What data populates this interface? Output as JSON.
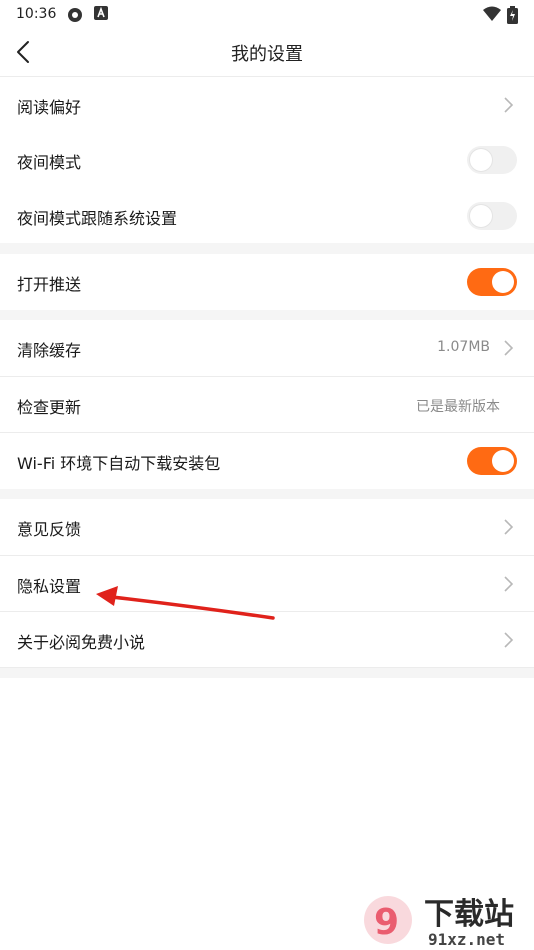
{
  "status_bar": {
    "time": "10:36"
  },
  "header": {
    "title": "我的设置"
  },
  "rows": [
    {
      "label": "阅读偏好"
    },
    {
      "label": "夜间模式",
      "toggle": false
    },
    {
      "label": "夜间模式跟随系统设置",
      "toggle": false
    },
    {
      "label": "打开推送",
      "toggle": true
    },
    {
      "label": "清除缓存",
      "value": "1.07MB"
    },
    {
      "label": "检查更新",
      "value": "已是最新版本"
    },
    {
      "label": "Wi-Fi 环境下自动下载安装包",
      "toggle": true
    },
    {
      "label": "意见反馈"
    },
    {
      "label": "隐私设置"
    },
    {
      "label": "关于必阅免费小说"
    }
  ],
  "colors": {
    "accent": "#ff6a13",
    "annotation_arrow": "#e0221b",
    "section_gap": "#f5f5f5"
  },
  "watermark": {
    "text": "下载站",
    "domain": "91xz.net"
  }
}
